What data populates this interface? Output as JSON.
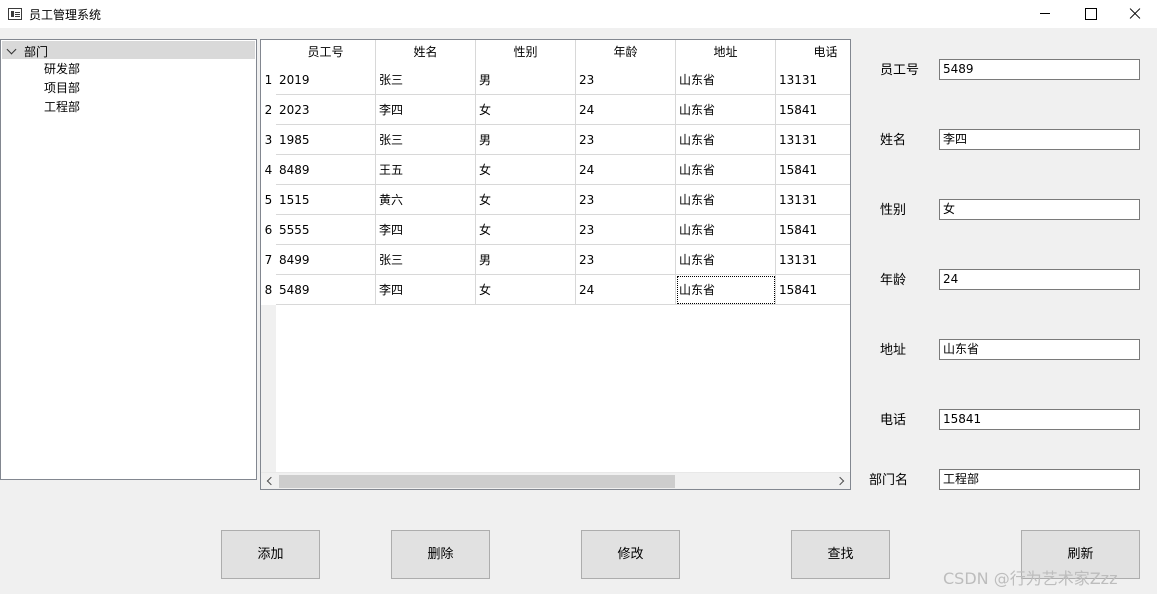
{
  "window": {
    "title": "员工管理系统"
  },
  "tree": {
    "root": "部门",
    "children": [
      "研发部",
      "项目部",
      "工程部"
    ]
  },
  "table": {
    "columns": [
      "员工号",
      "姓名",
      "性别",
      "年龄",
      "地址",
      "电话"
    ],
    "row_numbers": [
      "1",
      "2",
      "3",
      "4",
      "5",
      "6",
      "7",
      "8"
    ],
    "rows": [
      [
        "2019",
        "张三",
        "男",
        "23",
        "山东省",
        "13131"
      ],
      [
        "2023",
        "李四",
        "女",
        "24",
        "山东省",
        "15841"
      ],
      [
        "1985",
        "张三",
        "男",
        "23",
        "山东省",
        "13131"
      ],
      [
        "8489",
        "王五",
        "女",
        "24",
        "山东省",
        "15841"
      ],
      [
        "1515",
        "黄六",
        "女",
        "23",
        "山东省",
        "13131"
      ],
      [
        "5555",
        "李四",
        "女",
        "23",
        "山东省",
        "15841"
      ],
      [
        "8499",
        "张三",
        "男",
        "23",
        "山东省",
        "13131"
      ],
      [
        "5489",
        "李四",
        "女",
        "24",
        "山东省",
        "15841"
      ]
    ]
  },
  "form": {
    "fields": [
      {
        "label": "员工号",
        "value": "5489"
      },
      {
        "label": "姓名",
        "value": "李四"
      },
      {
        "label": "性别",
        "value": "女"
      },
      {
        "label": "年龄",
        "value": "24"
      },
      {
        "label": "地址",
        "value": "山东省"
      },
      {
        "label": "电话",
        "value": "15841"
      },
      {
        "label": "部门名",
        "value": "工程部"
      }
    ]
  },
  "buttons": {
    "add": "添加",
    "delete": "删除",
    "modify": "修改",
    "search": "查找",
    "refresh": "刷新"
  },
  "watermark": "CSDN @行为艺术家Zzz"
}
